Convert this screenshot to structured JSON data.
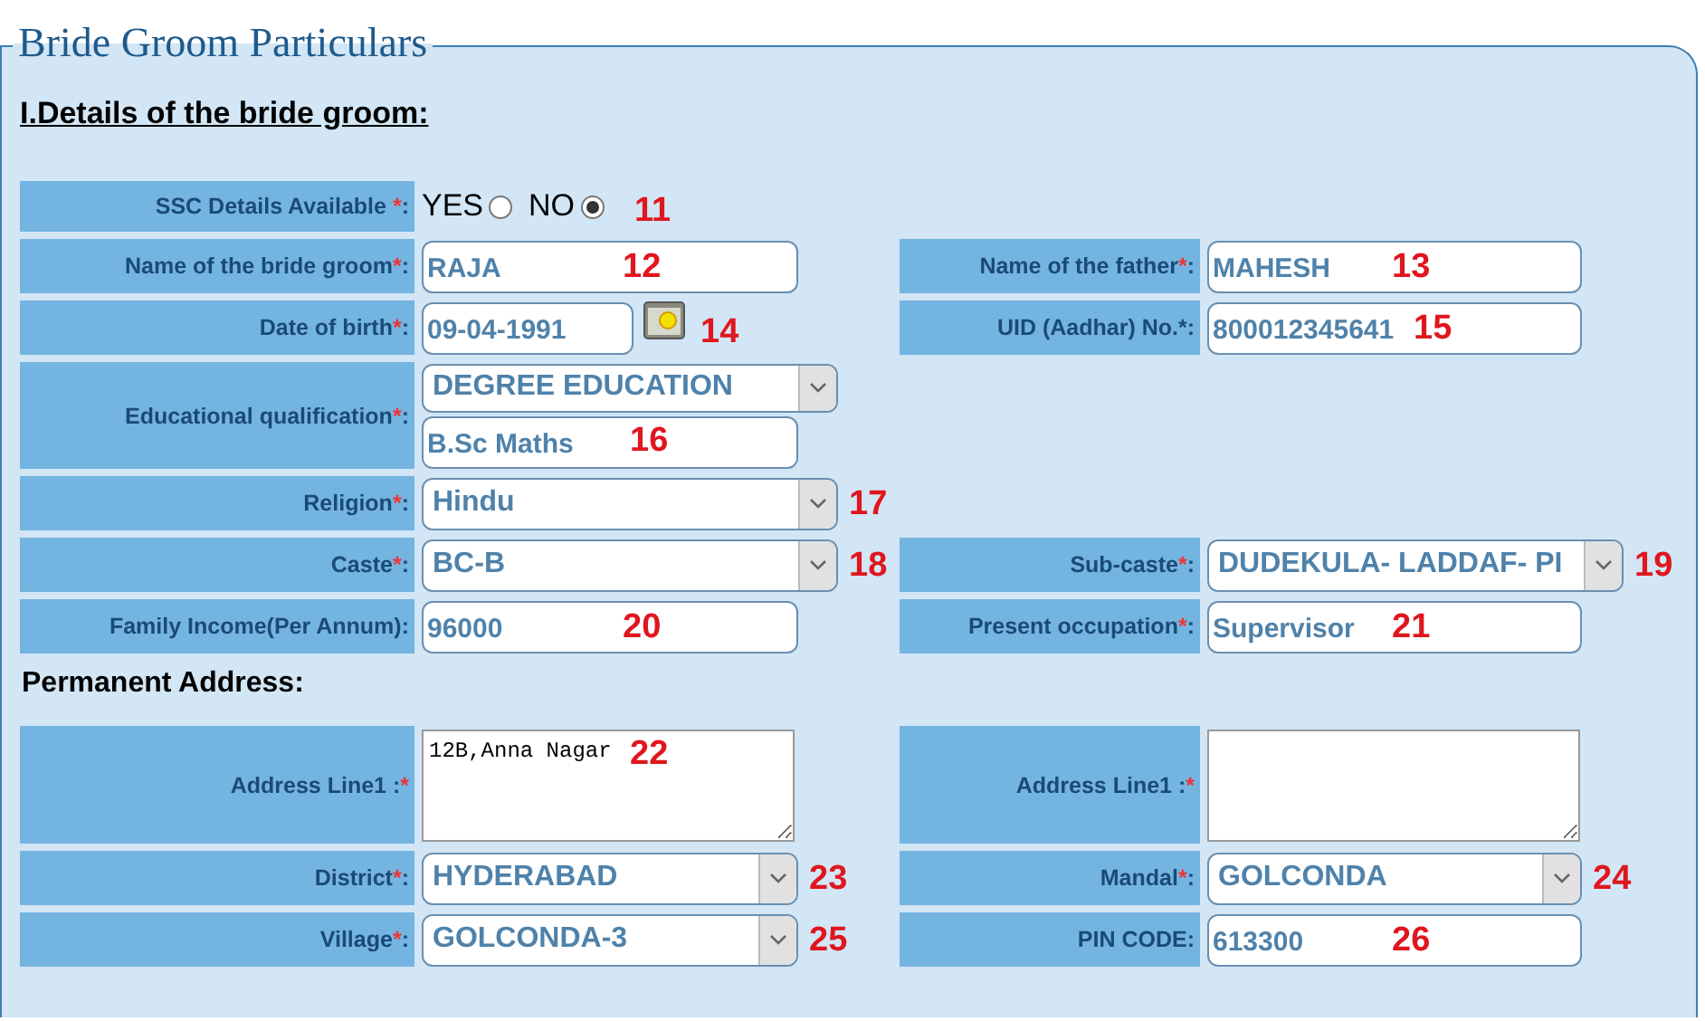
{
  "legend": "Bride Groom Particulars",
  "heading": "I.Details of the bride groom:",
  "rows": [
    {
      "left": {
        "kind": "radio",
        "label": "SSC Details Available ",
        "asterisk": "*",
        "tail": ":",
        "options": [
          {
            "label": "YES",
            "selected": false
          },
          {
            "label": "NO",
            "selected": true
          }
        ],
        "annotation": "11"
      }
    },
    {
      "left": {
        "kind": "text",
        "label": "Name of the bride groom",
        "asterisk": "*",
        "tail": ":",
        "value": "RAJA",
        "annotation": "12"
      },
      "right": {
        "kind": "text",
        "label": "Name of the father",
        "asterisk": "*",
        "tail": ":",
        "value": "MAHESH",
        "annotation": "13"
      }
    },
    {
      "left": {
        "kind": "date",
        "label": "Date of birth",
        "asterisk": "*",
        "tail": ":",
        "value": "09-04-1991",
        "annotation": "14"
      },
      "right": {
        "kind": "text",
        "label": "UID (Aadhar) No.*:",
        "value": "800012345641",
        "annotation": "15"
      }
    },
    {
      "left": {
        "kind": "education",
        "label": "Educational qualification",
        "asterisk": "*",
        "tail": ":",
        "value": "DEGREE EDUCATION",
        "detail": "B.Sc Maths",
        "annotation": "16"
      }
    },
    {
      "left": {
        "kind": "select",
        "label": "Religion",
        "asterisk": "*",
        "tail": ":",
        "value": "Hindu",
        "annotation": "17"
      }
    },
    {
      "left": {
        "kind": "select",
        "label": "Caste",
        "asterisk": "*",
        "tail": ":",
        "value": "BC-B",
        "annotation": "18"
      },
      "right": {
        "kind": "select",
        "label": "Sub-caste",
        "asterisk": "*",
        "tail": ":",
        "value": "DUDEKULA- LADDAF- PI",
        "annotation": "19"
      }
    },
    {
      "left": {
        "kind": "text",
        "label": "Family Income(Per Annum):",
        "value": "96000",
        "annotation": "20"
      },
      "right": {
        "kind": "text",
        "label": "Present occupation",
        "asterisk": "*",
        "tail": ":",
        "value": "Supervisor",
        "annotation": "21"
      }
    }
  ],
  "address_heading": "Permanent Address:",
  "address_rows": [
    {
      "left": {
        "kind": "textarea",
        "label": "Address Line1 :",
        "asterisk": "*",
        "value": "12B,Anna Nagar",
        "annotation": "22"
      },
      "right": {
        "kind": "textarea",
        "label": "Address Line1 :",
        "asterisk": "*"
      }
    },
    {
      "left": {
        "kind": "select",
        "label": "District",
        "asterisk": "*",
        "tail": ":",
        "value": "HYDERABAD",
        "annotation": "23"
      },
      "right": {
        "kind": "select",
        "label": "Mandal",
        "asterisk": "*",
        "tail": ":",
        "value": "GOLCONDA",
        "annotation": "24"
      }
    },
    {
      "left": {
        "kind": "select",
        "label": "Village",
        "asterisk": "*",
        "tail": ":",
        "value": "GOLCONDA-3",
        "annotation": "25"
      },
      "right": {
        "kind": "text",
        "label": "PIN CODE:",
        "value": "613300",
        "annotation": "26"
      }
    }
  ]
}
